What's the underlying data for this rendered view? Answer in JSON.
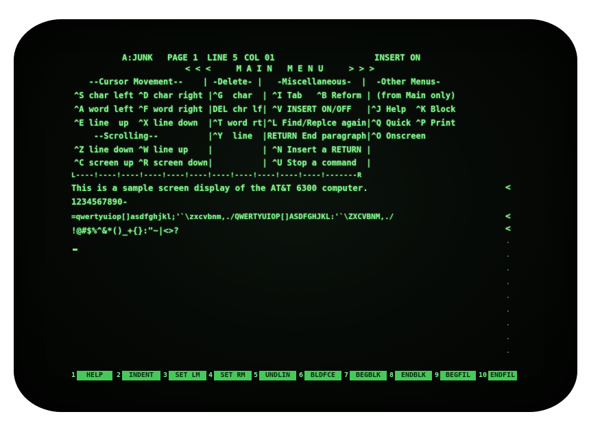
{
  "status": {
    "file": "A:JUNK",
    "page": "PAGE 1",
    "line": "LINE 5",
    "col": "COL 01",
    "mode": "INSERT ON"
  },
  "menu_title": "< < <     M A I N   M E N U     > > >",
  "menu_lines": [
    "   --Cursor Movement--    | -Delete- |   -Miscellaneous-  |  -Other Menus-",
    "^S char left ^D char right |^G  char  | ^I Tab   ^B Reform | (from Main only)",
    "^A word left ^F word right |DEL chr lf| ^V INSERT ON/OFF   |^J Help  ^K Block",
    "^E line  up  ^X line down  |^T word rt|^L Find/Replce again|^Q Quick ^P Print",
    "    --Scrolling--          |^Y  line  |RETURN End paragraph|^O Onscreen",
    "^Z line down ^W line up    |          | ^N Insert a RETURN |",
    "^C screen up ^R screen down|          | ^U Stop a command  |"
  ],
  "ruler": "L----!----!----!----!----!----!----!----!----!----!----!-------R",
  "document_lines": [
    "This is a sample screen display of the AT&T 6300 computer.",
    "1234567890-",
    "=qwertyuiop[]asdfghjkl;'`\\zxcvbnm,./QWERTYUIOP[]ASDFGHJKL:'`\\ZXCVBNM,./",
    "!@#$%^&*()_+{}:\"~|<>?"
  ],
  "margin_flag": "<",
  "function_keys": [
    {
      "num": "1",
      "label": "HELP"
    },
    {
      "num": "2",
      "label": "INDENT"
    },
    {
      "num": "3",
      "label": "SET LM"
    },
    {
      "num": "4",
      "label": "SET RM"
    },
    {
      "num": "5",
      "label": "UNDLIN"
    },
    {
      "num": "6",
      "label": "BLDFCE"
    },
    {
      "num": "7",
      "label": "BEGBLK"
    },
    {
      "num": "8",
      "label": "ENDBLK"
    },
    {
      "num": "9",
      "label": "BEGFIL"
    },
    {
      "num": "10",
      "label": "ENDFIL"
    }
  ],
  "colors": {
    "phosphor": "#7ef58a",
    "fkey_bg": "#47c95a",
    "screen": "#050805"
  }
}
